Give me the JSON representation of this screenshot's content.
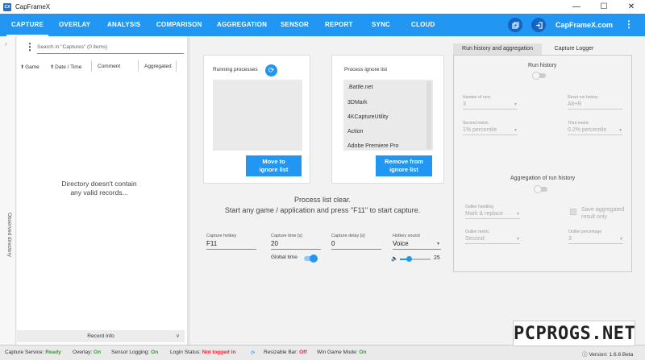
{
  "window": {
    "title": "CapFrameX",
    "icon_text": "CX"
  },
  "nav": {
    "tabs": [
      "CAPTURE",
      "OVERLAY",
      "ANALYSIS",
      "COMPARISON",
      "AGGREGATION",
      "SENSOR",
      "REPORT",
      "SYNC",
      "CLOUD"
    ],
    "active_tab": "CAPTURE",
    "brand": "CapFrameX.com",
    "accent": "#2196f3"
  },
  "sidebar": {
    "observed_label": "Observed directory"
  },
  "records": {
    "search_placeholder": "Search in \"Captures\" (0 items)",
    "columns": [
      "Game",
      "Date / Time",
      "Comment",
      "Aggregated"
    ],
    "empty_message_line1": "Directory doesn't contain",
    "empty_message_line2": "any valid records...",
    "record_info": "Record Info"
  },
  "running": {
    "title": "Running processes",
    "move_button_line1": "Move to",
    "move_button_line2": "ignore list"
  },
  "ignore": {
    "title": "Process ignore list",
    "items": [
      ".Battle.net",
      "3DMark",
      "4KCaptureUtility",
      "Action",
      "Adobe Premiere Pro"
    ],
    "remove_button_line1": "Remove from",
    "remove_button_line2": "ignore list"
  },
  "status_message": {
    "line1": "Process list clear.",
    "line2": "Start any game / application and press \"F11\" to start capture."
  },
  "capture_settings": {
    "hotkey_label": "Capture hotkey",
    "hotkey_value": "F11",
    "time_label": "Capture time [s]",
    "time_value": "20",
    "delay_label": "Capture delay [s]",
    "delay_value": "0",
    "sound_label": "Hotkey sound",
    "sound_value": "Voice",
    "global_time_label": "Global time",
    "volume_value": "25",
    "volume_fraction": 0.3
  },
  "right_panel": {
    "tabs": [
      "Run history and aggregation",
      "Capture Logger"
    ],
    "run_history_label": "Run history",
    "number_of_runs_label": "Number of runs",
    "number_of_runs_value": "3",
    "reset_label": "Reset run history",
    "reset_value": "Alt+R",
    "second_metric_label": "Second metric",
    "second_metric_value": "1% percentile",
    "third_metric_label": "Third metric",
    "third_metric_value": "0.2% percentile",
    "aggregation_label": "Aggregation of run history",
    "outlier_handling_label": "Outlier handling",
    "outlier_handling_value": "Mark & replace",
    "save_aggregated_line1": "Save aggregated",
    "save_aggregated_line2": "result only",
    "outlier_metric_label": "Outlier metric",
    "outlier_metric_value": "Second",
    "outlier_percentage_label": "Outlier percentage",
    "outlier_percentage_value": "3"
  },
  "statusbar": {
    "capture_service_label": "Capture Service:",
    "capture_service_value": "Ready",
    "overlay_label": "Overlay:",
    "overlay_value": "On",
    "sensor_label": "Sensor Logging:",
    "sensor_value": "On",
    "login_label": "Login Status:",
    "login_value": "Not logged in",
    "resizable_label": "Resizable Bar:",
    "resizable_value": "Off",
    "game_mode_label": "Win Game Mode:",
    "game_mode_value": "On",
    "version_label": "Version:",
    "version_value": "1.6.6 Beta"
  },
  "watermark": "PCPROGS.NET"
}
